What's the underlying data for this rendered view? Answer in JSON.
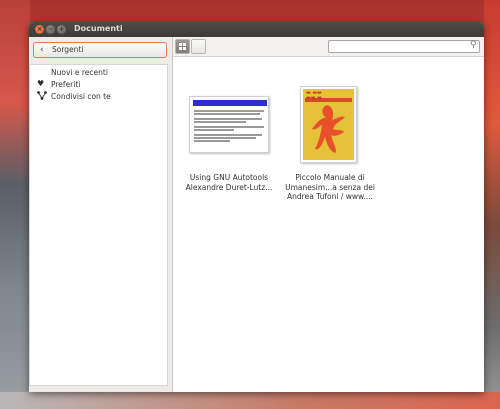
{
  "window": {
    "title": "Documenti",
    "controls": {
      "close": "×",
      "minimize": "−",
      "maximize": "+"
    }
  },
  "sidebar": {
    "sources_label": "Sorgenti",
    "items": [
      {
        "label": "Nuovi e recenti",
        "icon": ""
      },
      {
        "label": "Preferiti",
        "icon": "heart-icon"
      },
      {
        "label": "Condivisi con te",
        "icon": "share-icon"
      }
    ]
  },
  "toolbar": {
    "search_placeholder": ""
  },
  "documents": [
    {
      "line1": "Using GNU Autotools",
      "line2": "Alexandre Duret-Lutz..."
    },
    {
      "line1": "Piccolo Manuale di",
      "line2": "Umanesim...a senza dei",
      "line3": "Andrea Tufoni / www...."
    }
  ],
  "colors": {
    "accent_border": "#e07a4a",
    "titlebar": "#3c3b37",
    "close_button": "#e0501f"
  }
}
